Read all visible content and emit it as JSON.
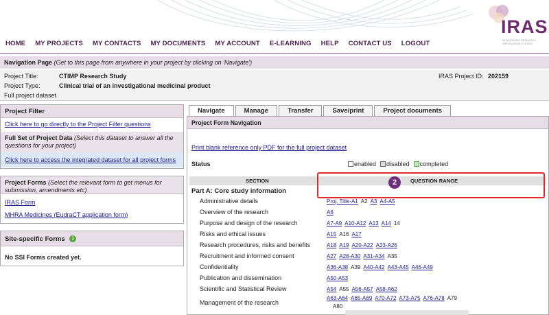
{
  "logo": {
    "text": "IRAS",
    "subtitle": "INTEGRATED RESEARCH APPLICATION SYSTEM"
  },
  "topnav": [
    "HOME",
    "MY PROJECTS",
    "MY CONTACTS",
    "MY DOCUMENTS",
    "MY ACCOUNT",
    "E-LEARNING",
    "HELP",
    "CONTACT US",
    "LOGOUT"
  ],
  "navigation_page": {
    "title": "Navigation Page",
    "hint": "(Get to this page from anywhere in your project by clicking on 'Navigate')"
  },
  "project": {
    "title_label": "Project Title:",
    "title_value": "CTIMP Research Study",
    "type_label": "Project Type:",
    "type_value": "Clinical trial of an investigational medicinal product",
    "dataset": "Full project dataset",
    "id_label": "IRAS Project ID:",
    "id_value": "202159"
  },
  "project_filter": {
    "heading": "Project Filter",
    "link": "Click here to go directly to the Project Filter questions",
    "full_set_title": "Full Set of Project Data",
    "full_set_hint": "(Select this dataset to answer all the questions for your project)",
    "integrated_link": "Click here to access the integrated dataset for all project forms"
  },
  "project_forms": {
    "title": "Project Forms",
    "hint": "(Select the relevant form to get menus for submission, amendments etc)",
    "links": [
      "IRAS Form",
      "MHRA Medicines (EudraCT application form)"
    ]
  },
  "site_specific": {
    "heading": "Site-specific Forms",
    "empty": "No SSI Forms created yet."
  },
  "tabs": [
    "Navigate",
    "Manage",
    "Transfer",
    "Save/print",
    "Project documents"
  ],
  "form_nav": {
    "heading": "Project Form Navigation",
    "pdf_link": "Print blank reference only PDF for the full project dataset",
    "status_label": "Status",
    "legend": [
      "enabled",
      "disabled",
      "completed"
    ],
    "col_section": "SECTION",
    "col_range": "QUESTION RANGE",
    "badge": "2",
    "part_a": "Part A: Core study information",
    "sections": [
      {
        "name": "Administrative details",
        "ranges": [
          [
            "Proj. Title-A1",
            true
          ],
          [
            "A2",
            false
          ],
          [
            "A3",
            true
          ],
          [
            "A4-A5",
            true
          ]
        ]
      },
      {
        "name": "Overview of the research",
        "ranges": [
          [
            "A6",
            true
          ]
        ]
      },
      {
        "name": "Purpose and design of the research",
        "ranges": [
          [
            "A7-A9",
            true
          ],
          [
            "A10-A12",
            true
          ],
          [
            "A13",
            true
          ],
          [
            "A14",
            true
          ],
          [
            "14",
            false
          ]
        ]
      },
      {
        "name": "Risks and ethical issues",
        "ranges": [
          [
            "A15",
            true
          ],
          [
            "A16",
            false
          ],
          [
            "A17",
            true
          ]
        ]
      },
      {
        "name": "Research procedures, risks and benefits",
        "ranges": [
          [
            "A18",
            true
          ],
          [
            "A19",
            true
          ],
          [
            "A20-A22",
            true
          ],
          [
            "A23-A26",
            true
          ]
        ]
      },
      {
        "name": "Recruitment and informed consent",
        "ranges": [
          [
            "A27",
            true
          ],
          [
            "A28-A30",
            true
          ],
          [
            "A31-A34",
            true
          ],
          [
            "A35",
            false
          ]
        ]
      },
      {
        "name": "Confidentiality",
        "ranges": [
          [
            "A36-A38",
            true
          ],
          [
            "A39",
            false
          ],
          [
            "A40-A42",
            true
          ],
          [
            "A43-A45",
            true
          ],
          [
            "A46-A49",
            true
          ]
        ]
      },
      {
        "name": "Publication and dissemination",
        "ranges": [
          [
            "A50-A53",
            true
          ]
        ]
      },
      {
        "name": "Scientific and Statistical Review",
        "ranges": [
          [
            "A54",
            true
          ],
          [
            "A55",
            false
          ],
          [
            "A56-A57",
            true
          ],
          [
            "A58-A62",
            true
          ]
        ]
      },
      {
        "name": "Management of the research",
        "ranges": [
          [
            "A63-A64",
            true
          ],
          [
            "A65-A69",
            true
          ],
          [
            "A70-A72",
            true
          ],
          [
            "A73-A75",
            true
          ],
          [
            "A76-A78",
            true
          ],
          [
            "A79",
            false
          ]
        ],
        "extra": "A80"
      }
    ]
  }
}
